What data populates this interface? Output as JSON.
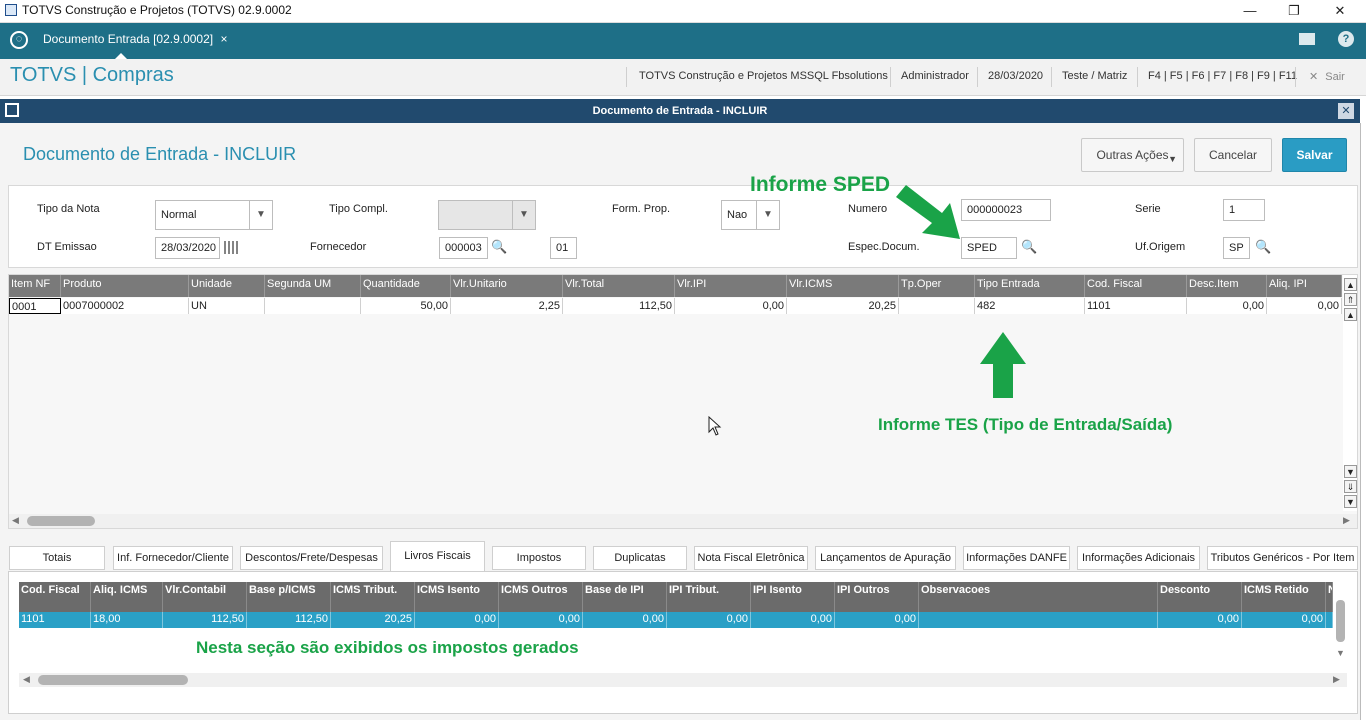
{
  "os": {
    "title": "TOTVS Construção e Projetos (TOTVS) 02.9.0002",
    "min": "—",
    "restore": "❐",
    "close": "✕"
  },
  "tabbar": {
    "tab_label": "Documento Entrada [02.9.0002]",
    "tab_close": "×"
  },
  "header": {
    "brand": "TOTVS | Compras",
    "company": "TOTVS Construção e Projetos MSSQL Fbsolutions",
    "user": "Administrador",
    "date": "28/03/2020",
    "branch": "Teste / Matriz",
    "keys": "F4 | F5 | F6 | F7 | F8 | F9 | F11",
    "exit": "Sair"
  },
  "dialog": {
    "title": "Documento de Entrada - INCLUIR",
    "page_title": "Documento de Entrada - INCLUIR"
  },
  "actions": {
    "other": "Outras Ações",
    "cancel": "Cancelar",
    "save": "Salvar"
  },
  "form": {
    "tipo_nota_label": "Tipo da Nota",
    "tipo_nota_value": "Normal",
    "tipo_compl_label": "Tipo Compl.",
    "tipo_compl_value": "",
    "form_prop_label": "Form. Prop.",
    "form_prop_value": "Nao",
    "numero_label": "Numero",
    "numero_value": "000000023",
    "serie_label": "Serie",
    "serie_value": "1",
    "dt_emissao_label": "DT Emissao",
    "dt_emissao_value": "28/03/2020",
    "fornecedor_label": "Fornecedor",
    "fornecedor_value": "000003",
    "loja_value": "01",
    "espec_label": "Espec.Docum.",
    "espec_value": "SPED",
    "uf_label": "Uf.Origem",
    "uf_value": "SP"
  },
  "items_grid": {
    "columns": [
      "Item NF",
      "Produto",
      "Unidade",
      "Segunda UM",
      "Quantidade",
      "Vlr.Unitario",
      "Vlr.Total",
      "Vlr.IPI",
      "Vlr.ICMS",
      "Tp.Oper",
      "Tipo Entrada",
      "Cod. Fiscal",
      "Desc.Item",
      "Aliq. IPI"
    ],
    "row": [
      "0001",
      "0007000002",
      "UN",
      "",
      "50,00",
      "2,25",
      "112,50",
      "0,00",
      "20,25",
      "",
      "482",
      "1101",
      "0,00",
      "0,00"
    ]
  },
  "tabs": [
    "Totais",
    "Inf. Fornecedor/Cliente",
    "Descontos/Frete/Despesas",
    "Livros Fiscais",
    "Impostos",
    "Duplicatas",
    "Nota Fiscal Eletrônica",
    "Lançamentos de Apuração",
    "Informações DANFE",
    "Informações Adicionais",
    "Tributos Genéricos - Por Item"
  ],
  "active_tab": "Livros Fiscais",
  "livros_grid": {
    "columns": [
      "Cod. Fiscal",
      "Aliq. ICMS",
      "Vlr.Contabil",
      "Base p/ICMS",
      "ICMS Tribut.",
      "ICMS Isento",
      "ICMS Outros",
      "Base de IPI",
      "IPI Tribut.",
      "IPI Isento",
      "IPI Outros",
      "Observacoes",
      "Desconto",
      "ICMS Retido",
      "N"
    ],
    "row": [
      "1101",
      "18,00",
      "112,50",
      "112,50",
      "20,25",
      "0,00",
      "0,00",
      "0,00",
      "0,00",
      "0,00",
      "0,00",
      "",
      "0,00",
      "0,00",
      ""
    ]
  },
  "annotations": {
    "sped": "Informe SPED",
    "tes": "Informe TES (Tipo de Entrada/Saída)",
    "impostos": "Nesta seção são exibidos os impostos gerados"
  },
  "colors": {
    "teal": "#1e6f87",
    "brand": "#2a8fb0",
    "dialog_bar": "#214a6e",
    "selection": "#2aa0c6",
    "annotation": "#1aa348"
  }
}
